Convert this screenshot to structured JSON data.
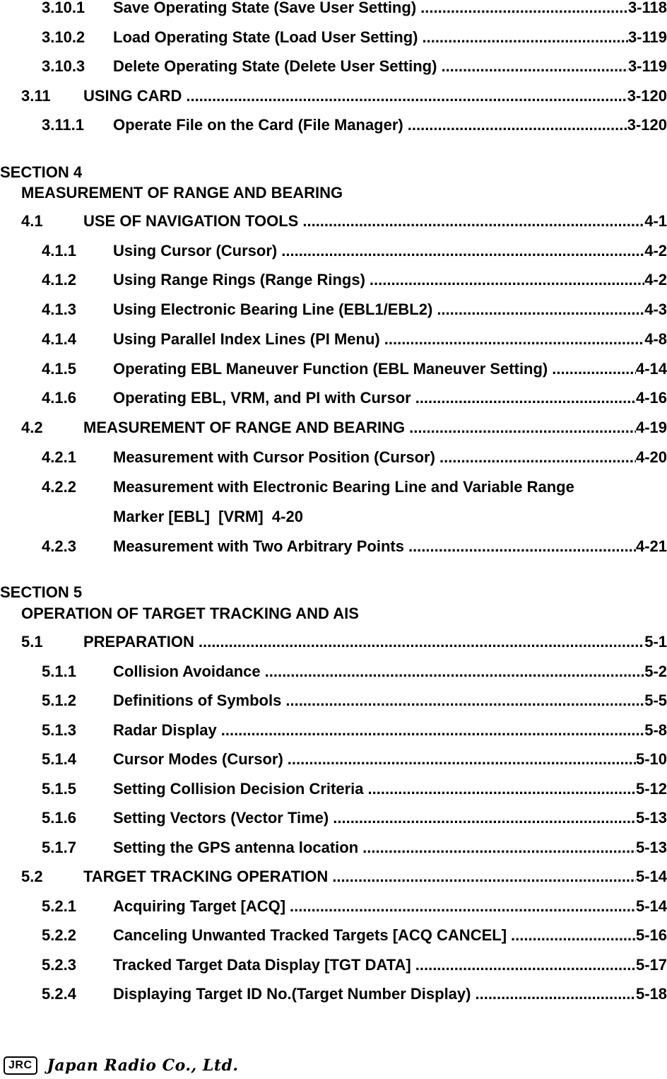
{
  "toc_top": [
    {
      "level": 3,
      "number": "3.10.1",
      "title": "Save Operating State (Save User Setting)",
      "page": "3-118"
    },
    {
      "level": 3,
      "number": "3.10.2",
      "title": "Load Operating State (Load User Setting)",
      "page": "3-119"
    },
    {
      "level": 3,
      "number": "3.10.3",
      "title": "Delete Operating State (Delete User Setting)",
      "page": "3-119"
    },
    {
      "level": 2,
      "number": "3.11",
      "title": "USING CARD",
      "page": "3-120"
    },
    {
      "level": 3,
      "number": "3.11.1",
      "title": "Operate File on the Card (File Manager)",
      "page": "3-120"
    }
  ],
  "section4": {
    "label": "SECTION 4",
    "title": "MEASUREMENT OF RANGE AND BEARING",
    "entries": [
      {
        "level": 2,
        "number": "4.1",
        "title": "USE OF NAVIGATION TOOLS",
        "page": "4-1"
      },
      {
        "level": 3,
        "number": "4.1.1",
        "title": "Using Cursor (Cursor)",
        "page": "4-2"
      },
      {
        "level": 3,
        "number": "4.1.2",
        "title": "Using Range Rings (Range Rings)",
        "page": "4-2"
      },
      {
        "level": 3,
        "number": "4.1.3",
        "title": "Using Electronic Bearing Line (EBL1/EBL2)",
        "page": "4-3"
      },
      {
        "level": 3,
        "number": "4.1.4",
        "title": "Using Parallel Index Lines (PI Menu)",
        "page": "4-8"
      },
      {
        "level": 3,
        "number": "4.1.5",
        "title": "Operating EBL Maneuver Function (EBL Maneuver Setting)",
        "page": "4-14"
      },
      {
        "level": 3,
        "number": "4.1.6",
        "title": "Operating EBL, VRM, and PI with Cursor",
        "page": "4-16"
      },
      {
        "level": 2,
        "number": "4.2",
        "title": "MEASUREMENT OF RANGE AND BEARING",
        "page": "4-19"
      },
      {
        "level": 3,
        "number": "4.2.1",
        "title": "Measurement with Cursor Position (Cursor)",
        "page": "4-20"
      }
    ],
    "wrapped_entry": {
      "number": "4.2.2",
      "line1": "Measurement with Electronic Bearing Line and Variable Range",
      "line2": "Marker [EBL]  [VRM]  4-20"
    },
    "last_entry": {
      "level": 3,
      "number": "4.2.3",
      "title": "Measurement with Two Arbitrary Points",
      "page": "4-21"
    }
  },
  "section5": {
    "label": "SECTION 5",
    "title": "OPERATION OF TARGET TRACKING AND AIS",
    "entries": [
      {
        "level": 2,
        "number": "5.1",
        "title": "PREPARATION",
        "page": "5-1"
      },
      {
        "level": 3,
        "number": "5.1.1",
        "title": "Collision Avoidance",
        "page": "5-2"
      },
      {
        "level": 3,
        "number": "5.1.2",
        "title": "Definitions of Symbols",
        "page": "5-5"
      },
      {
        "level": 3,
        "number": "5.1.3",
        "title": "Radar Display",
        "page": "5-8"
      },
      {
        "level": 3,
        "number": "5.1.4",
        "title": "Cursor Modes (Cursor)",
        "page": "5-10"
      },
      {
        "level": 3,
        "number": "5.1.5",
        "title": "Setting Collision Decision Criteria",
        "page": "5-12"
      },
      {
        "level": 3,
        "number": "5.1.6",
        "title": "Setting Vectors (Vector Time)",
        "page": "5-13"
      },
      {
        "level": 3,
        "number": "5.1.7",
        "title": "Setting the GPS antenna location",
        "page": "5-13"
      },
      {
        "level": 2,
        "number": "5.2",
        "title": "TARGET TRACKING OPERATION",
        "page": "5-14"
      },
      {
        "level": 3,
        "number": "5.2.1",
        "title": "Acquiring Target [ACQ]",
        "page": "5-14"
      },
      {
        "level": 3,
        "number": "5.2.2",
        "title": "Canceling Unwanted Tracked Targets [ACQ CANCEL]",
        "page": "5-16"
      },
      {
        "level": 3,
        "number": "5.2.3",
        "title": "Tracked Target Data Display [TGT DATA]",
        "page": "5-17"
      },
      {
        "level": 3,
        "number": "5.2.4",
        "title": "Displaying Target ID No.(Target Number Display)",
        "page": "5-18"
      }
    ]
  },
  "footer": {
    "logo_text": "JRC",
    "company_name": "Japan Radio Co., Ltd."
  }
}
